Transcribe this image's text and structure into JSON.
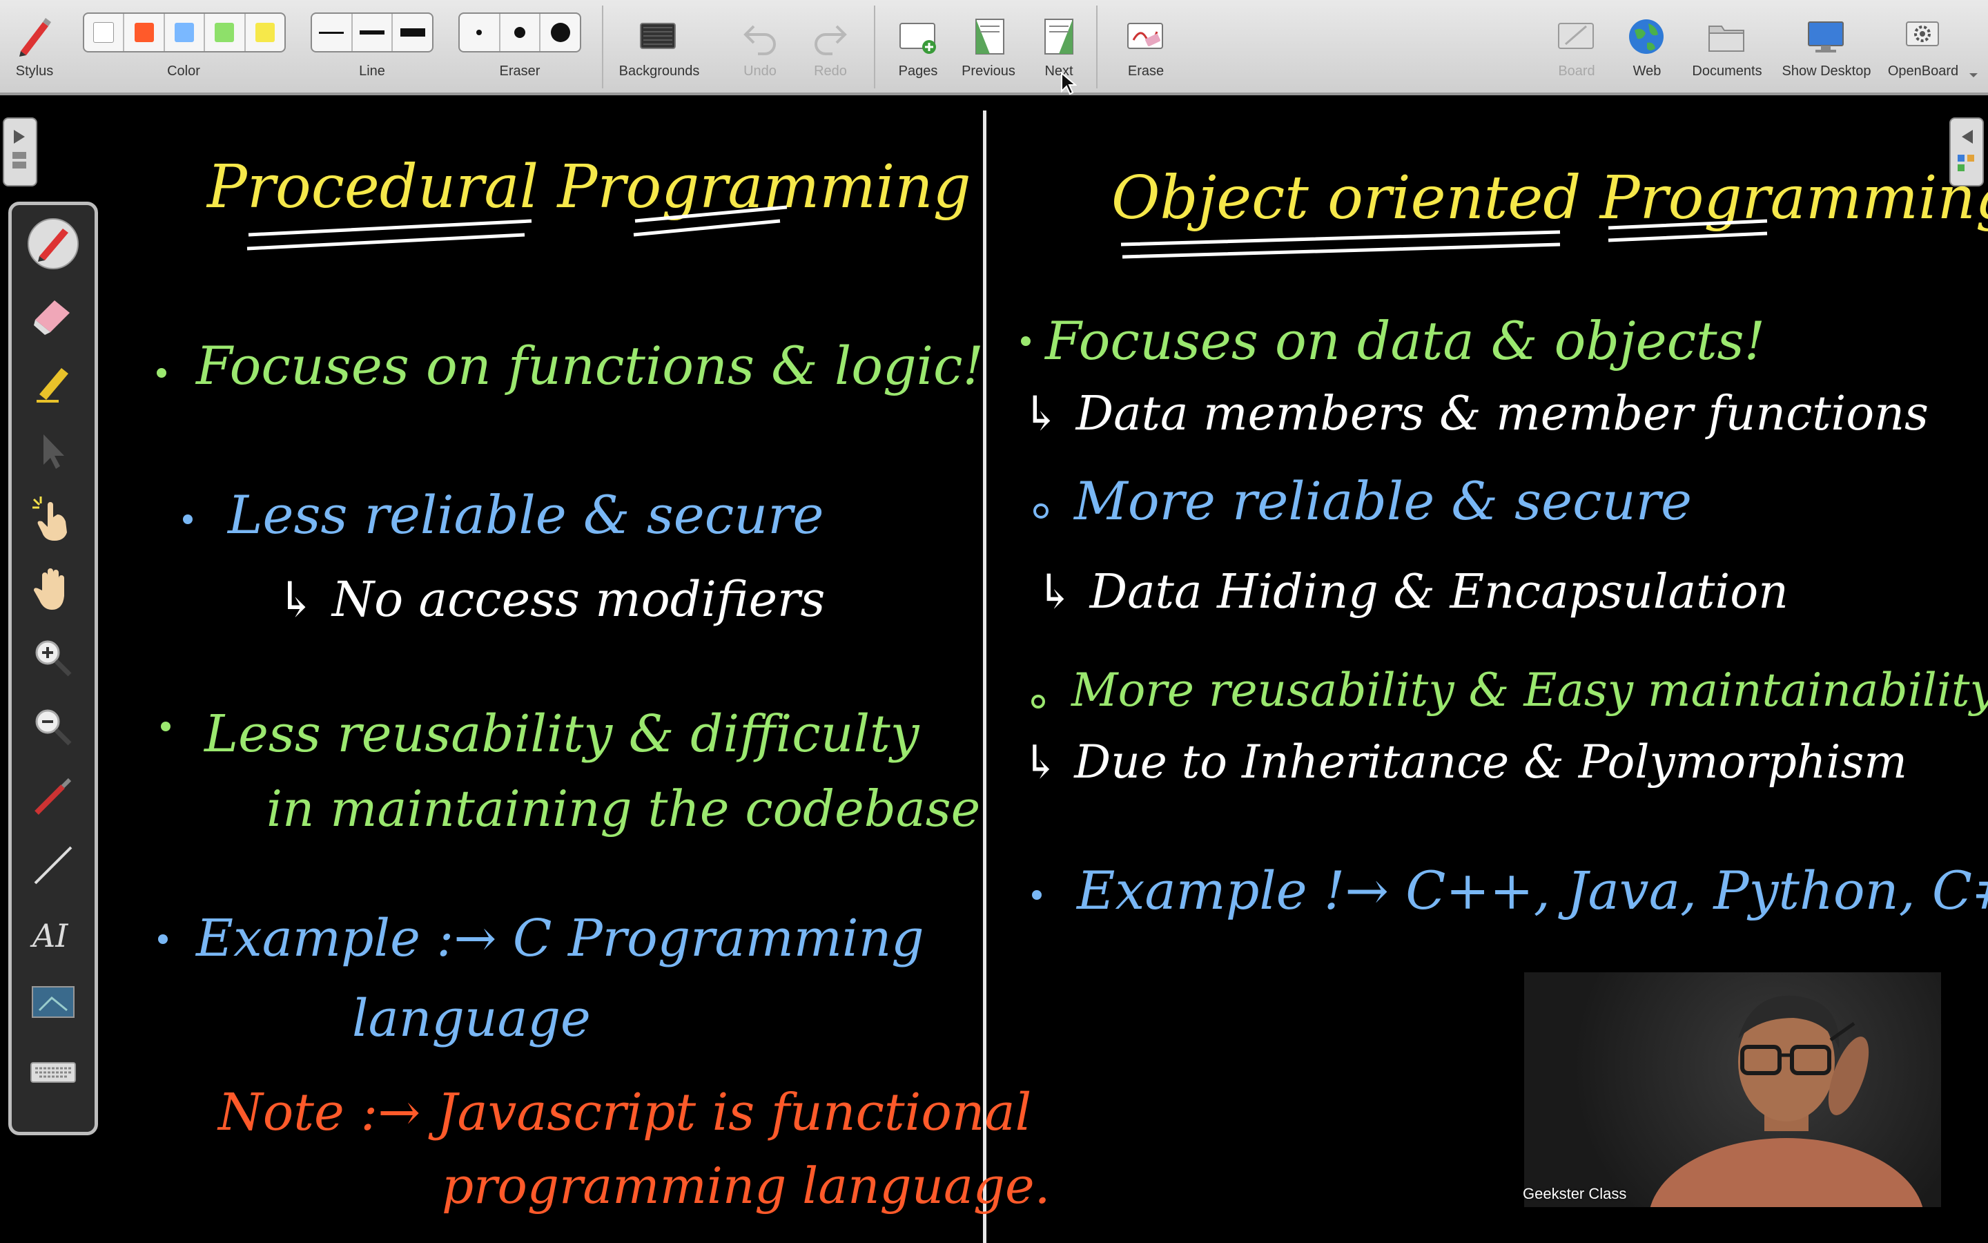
{
  "toolbar": {
    "items": [
      {
        "id": "stylus",
        "label": "Stylus"
      },
      {
        "id": "color",
        "label": "Color"
      },
      {
        "id": "line",
        "label": "Line"
      },
      {
        "id": "eraser",
        "label": "Eraser"
      },
      {
        "id": "backgrounds",
        "label": "Backgrounds"
      },
      {
        "id": "undo",
        "label": "Undo"
      },
      {
        "id": "redo",
        "label": "Redo"
      },
      {
        "id": "pages",
        "label": "Pages"
      },
      {
        "id": "previous",
        "label": "Previous"
      },
      {
        "id": "next",
        "label": "Next"
      },
      {
        "id": "erase",
        "label": "Erase"
      },
      {
        "id": "board",
        "label": "Board"
      },
      {
        "id": "web",
        "label": "Web"
      },
      {
        "id": "documents",
        "label": "Documents"
      },
      {
        "id": "show_desktop",
        "label": "Show Desktop"
      },
      {
        "id": "openboard",
        "label": "OpenBoard"
      }
    ],
    "colors": [
      "#ffffff",
      "#ff5a2a",
      "#7ab8ff",
      "#8ee06a",
      "#f6e84a"
    ]
  },
  "board": {
    "left": {
      "title": "Procedural Programming",
      "points": [
        {
          "text": "Focuses on functions & logic!",
          "color": "#9be86f"
        },
        {
          "text": "Less reliable & secure",
          "color": "#79b7f5"
        },
        {
          "text": "↳ No access modifiers",
          "color": "#ffffff"
        },
        {
          "text": "Less reusability & difficulty",
          "color": "#9be86f"
        },
        {
          "text": "in maintaining the codebase",
          "color": "#9be86f"
        },
        {
          "text": "Example :→ C Programming",
          "color": "#79b7f5"
        },
        {
          "text": "language",
          "color": "#79b7f5"
        },
        {
          "text": "Note :→ Javascript is functional",
          "color": "#ff5a2a"
        },
        {
          "text": "programming language.",
          "color": "#ff5a2a"
        }
      ]
    },
    "right": {
      "title": "Object oriented Programming",
      "points": [
        {
          "text": "Focuses on data & objects!",
          "color": "#9be86f"
        },
        {
          "text": "↳ Data members & member functions",
          "color": "#ffffff"
        },
        {
          "text": "More reliable & secure",
          "color": "#79b7f5"
        },
        {
          "text": "↳ Data Hiding & Encapsulation",
          "color": "#ffffff"
        },
        {
          "text": "More reusability & Easy maintainability",
          "color": "#9be86f"
        },
        {
          "text": "↳ Due to Inheritance & Polymorphism",
          "color": "#ffffff"
        },
        {
          "text": "Example !→ C++, Java, Python, C#",
          "color": "#79b7f5"
        }
      ]
    },
    "title_color": "#f6e84a"
  },
  "webcam": {
    "label": "Geekster Class"
  }
}
